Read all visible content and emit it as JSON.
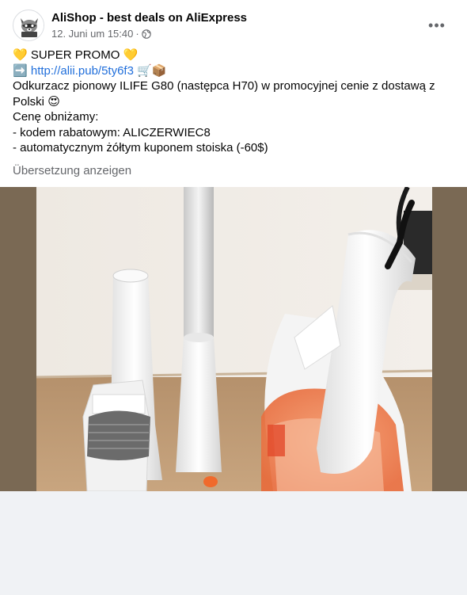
{
  "post": {
    "page_name": "AliShop - best deals on AliExpress",
    "timestamp": "12. Juni um 15:40",
    "separator": "·",
    "audience_icon": "globe-icon",
    "more_icon": "more-options-icon",
    "more_label": "•••",
    "lines": {
      "l1_emoji_a": "💛",
      "l1_text": " SUPER PROMO ",
      "l1_emoji_b": "💛",
      "l2_emoji": "➡️",
      "l2_link": "http://alii.pub/5ty6f3",
      "l2_emoji_b": "🛒📦",
      "l3": "Odkurzacz pionowy ILIFE G80 (następca H70) w promocyjnej cenie z dostawą z",
      "l4_text": "Polski ",
      "l4_emoji": "😍",
      "l5": "Cenę obniżamy:",
      "l6": "- kodem rabatowym: ALICZERWIEC8",
      "l7": "- automatycznym żółtym kuponem stoiska (-60$)"
    },
    "translate_label": "Übersetzung anzeigen"
  }
}
